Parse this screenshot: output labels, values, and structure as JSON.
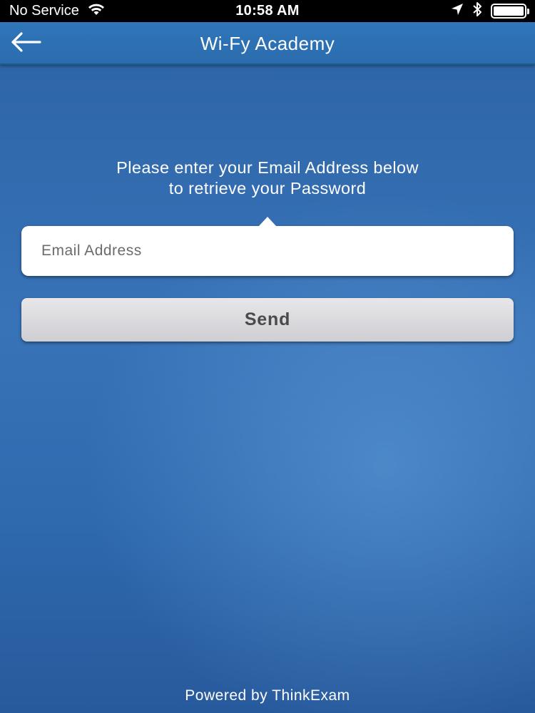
{
  "status_bar": {
    "carrier": "No Service",
    "time": "10:58 AM",
    "icons": [
      "wifi-icon",
      "location-arrow-icon",
      "bluetooth-icon",
      "battery-icon"
    ]
  },
  "nav": {
    "title": "Wi-Fy Academy",
    "back_icon": "back-arrow-icon"
  },
  "form": {
    "instruction_line1": "Please enter your Email Address below",
    "instruction_line2": "to retrieve your Password",
    "email_placeholder": "Email Address",
    "email_value": "",
    "send_label": "Send"
  },
  "footer": {
    "text": "Powered by ThinkExam"
  },
  "colors": {
    "nav_background": "#2f76ba",
    "page_background": "#3873b8",
    "button_background": "#dcdce0",
    "button_text": "#4a4a4a"
  }
}
